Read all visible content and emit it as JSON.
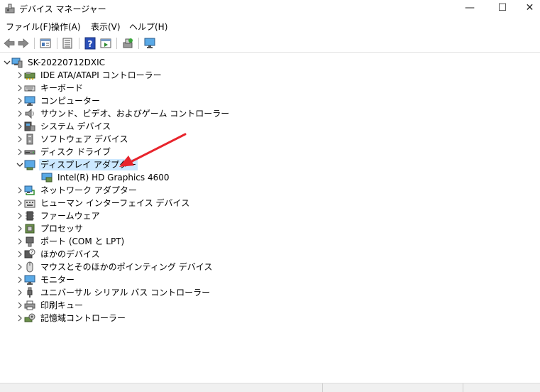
{
  "window": {
    "title": "デバイス マネージャー",
    "minimize_glyph": "—",
    "maximize_glyph": "☐",
    "close_glyph": "✕"
  },
  "menu": [
    "ファイル(F)",
    "操作(A)",
    "表示(V)",
    "ヘルプ(H)"
  ],
  "tree": {
    "root": "SK-20220712DXIC",
    "categories": [
      {
        "label": "IDE ATA/ATAPI コントローラー",
        "icon": "ide-controller-icon"
      },
      {
        "label": "キーボード",
        "icon": "keyboard-icon"
      },
      {
        "label": "コンピューター",
        "icon": "computer-icon"
      },
      {
        "label": "サウンド、ビデオ、およびゲーム コントローラー",
        "icon": "speaker-icon"
      },
      {
        "label": "システム デバイス",
        "icon": "system-device-icon"
      },
      {
        "label": "ソフトウェア デバイス",
        "icon": "software-device-icon"
      },
      {
        "label": "ディスク ドライブ",
        "icon": "disk-drive-icon"
      },
      {
        "label": "ディスプレイ アダプター",
        "icon": "display-adapter-icon",
        "expanded": true,
        "selected": true
      },
      {
        "label": "ネットワーク アダプター",
        "icon": "network-adapter-icon"
      },
      {
        "label": "ヒューマン インターフェイス デバイス",
        "icon": "hid-icon"
      },
      {
        "label": "ファームウェア",
        "icon": "firmware-icon"
      },
      {
        "label": "プロセッサ",
        "icon": "processor-icon"
      },
      {
        "label": "ポート (COM と LPT)",
        "icon": "port-icon"
      },
      {
        "label": "ほかのデバイス",
        "icon": "other-device-icon"
      },
      {
        "label": "マウスとそのほかのポインティング デバイス",
        "icon": "mouse-icon"
      },
      {
        "label": "モニター",
        "icon": "monitor-icon"
      },
      {
        "label": "ユニバーサル シリアル バス コントローラー",
        "icon": "usb-icon"
      },
      {
        "label": "印刷キュー",
        "icon": "printer-icon"
      },
      {
        "label": "記憶域コントローラー",
        "icon": "storage-controller-icon"
      }
    ],
    "display_child": "Intel(R) HD Graphics 4600"
  },
  "colors": {
    "selection": "#cce8ff",
    "annotation_arrow": "#e8242c"
  }
}
